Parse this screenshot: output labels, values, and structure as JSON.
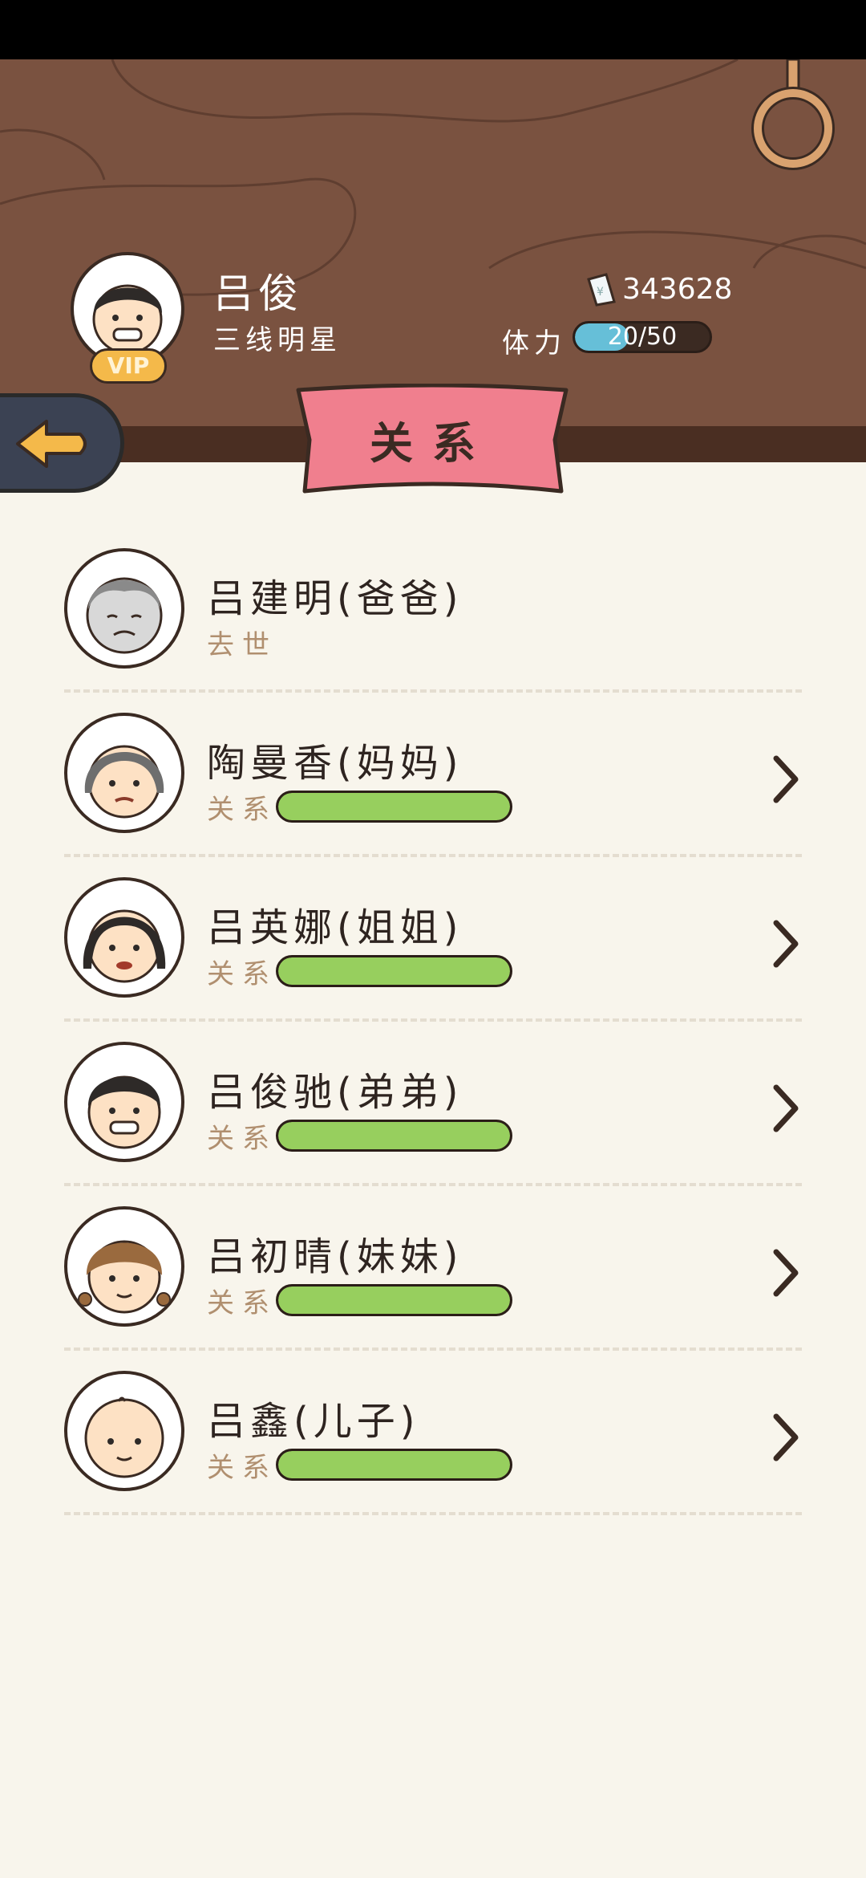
{
  "player": {
    "name": "吕俊",
    "title": "三线明星",
    "vip_label": "VIP",
    "money": "343628",
    "stamina_label": "体力",
    "stamina_text": "20/50",
    "stamina_fraction": 0.4
  },
  "page": {
    "title": "关系"
  },
  "relations": [
    {
      "name": "吕建明(爸爸)",
      "status": "去世",
      "deceased": true,
      "icon": "grandpa-avatar"
    },
    {
      "name": "陶曼香(妈妈)",
      "status": "关系",
      "level": 1.0,
      "icon": "mother-avatar"
    },
    {
      "name": "吕英娜(姐姐)",
      "status": "关系",
      "level": 1.0,
      "icon": "sister-avatar"
    },
    {
      "name": "吕俊驰(弟弟)",
      "status": "关系",
      "level": 1.0,
      "icon": "brother-avatar"
    },
    {
      "name": "吕初晴(妹妹)",
      "status": "关系",
      "level": 1.0,
      "icon": "younger-sister-avatar"
    },
    {
      "name": "吕鑫(儿子)",
      "status": "关系",
      "level": 1.0,
      "icon": "baby-son-avatar"
    }
  ],
  "colors": {
    "header_bg": "#7a5240",
    "ribbon": "#f07f8e",
    "bar_fill": "#97cf5e",
    "stamina_fill": "#66bfd8"
  }
}
